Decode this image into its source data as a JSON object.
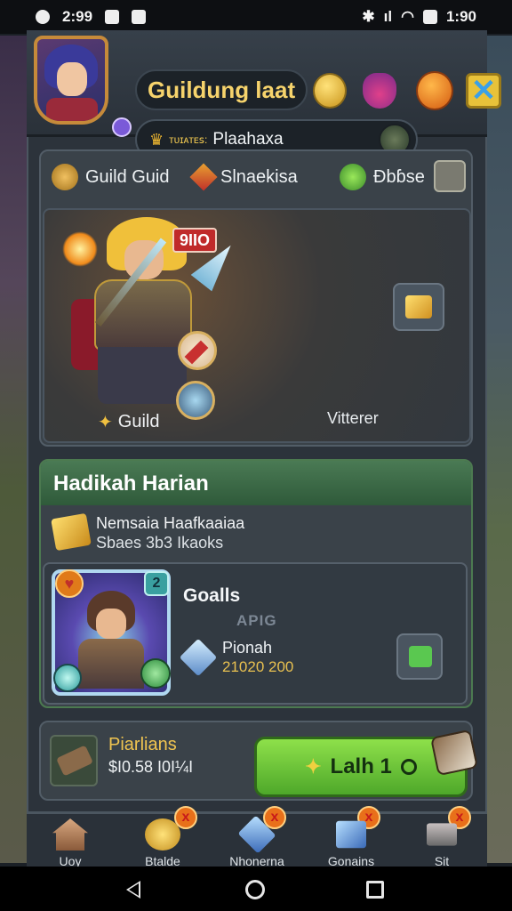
{
  "status_bar": {
    "time_left": "2:99",
    "time_right": "1:90"
  },
  "header": {
    "title": "Guildung laat",
    "guild_rank_small": "ᴛᴜɪᴀᴛᴇꜱ:",
    "guild_name": "Plaahaxa"
  },
  "tabs": [
    {
      "label": "Guild Guid"
    },
    {
      "label": "Slnaekisa"
    },
    {
      "label": "Ɖbɓse"
    }
  ],
  "hero": {
    "level_tag": "9IIO",
    "label": "Guild",
    "right_label": "Vitterer"
  },
  "daily": {
    "header": "Hadikah Harian",
    "quest_line1": "Nemsaia Haafkaaiaa",
    "quest_line2": "Sbaes 3b3 Ikaoks",
    "card_badge_number": "2",
    "card_title": "Goalls",
    "card_watermark": "APIG",
    "card_sub": "Pionah",
    "card_value": "21020 200"
  },
  "claim": {
    "title": "Piarlians",
    "value": "$I0.58 I0I¼I",
    "button_label": "Lalh 1"
  },
  "bottom_nav": [
    {
      "label": "Uoy",
      "badge": ""
    },
    {
      "label": "Btalde",
      "badge": "x"
    },
    {
      "label": "Nhonerna",
      "badge": "x"
    },
    {
      "label": "Gonains",
      "badge": "x"
    },
    {
      "label": "Sit",
      "badge": "x"
    }
  ],
  "colors": {
    "title_gold": "#f6d36c",
    "claim_green": "#8ee04a",
    "daily_header_green": "#4a7a54",
    "panel": "#3a4249"
  },
  "icons": [
    "avatar",
    "gold-coin-icon",
    "potion-icon",
    "orb-icon",
    "close-icon",
    "crown-icon",
    "treasure-chest-icon",
    "crystal-icon",
    "home-icon",
    "coin-icon",
    "gem-icon",
    "cube-icon",
    "shop-icon"
  ]
}
